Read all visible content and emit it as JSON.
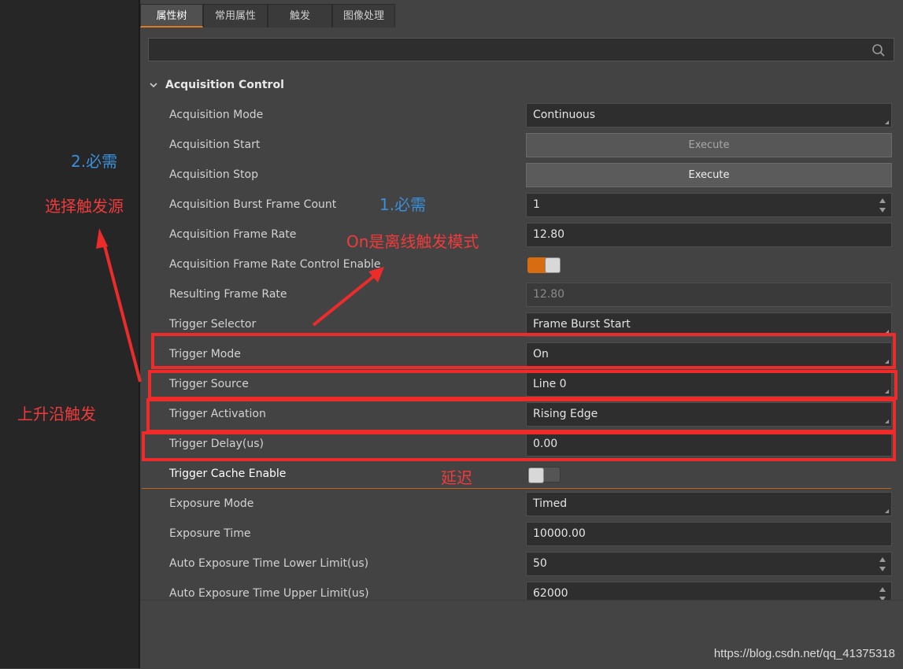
{
  "tabs": [
    "属性树",
    "常用属性",
    "触发",
    "图像处理"
  ],
  "search": {
    "placeholder": ""
  },
  "section": {
    "title": "Acquisition Control"
  },
  "rows": [
    {
      "label": "Acquisition Mode",
      "value": "Continuous"
    },
    {
      "label": "Acquisition Start",
      "value": "Execute"
    },
    {
      "label": "Acquisition Stop",
      "value": "Execute"
    },
    {
      "label": "Acquisition Burst Frame Count",
      "value": "1"
    },
    {
      "label": "Acquisition Frame Rate",
      "value": "12.80"
    },
    {
      "label": "Acquisition Frame Rate Control Enable",
      "value": "on"
    },
    {
      "label": "Resulting Frame Rate",
      "value": "12.80"
    },
    {
      "label": "Trigger Selector",
      "value": "Frame Burst Start"
    },
    {
      "label": "Trigger Mode",
      "value": "On"
    },
    {
      "label": "Trigger Source",
      "value": "Line 0"
    },
    {
      "label": "Trigger Activation",
      "value": "Rising Edge"
    },
    {
      "label": "Trigger Delay(us)",
      "value": "0.00"
    },
    {
      "label": "Trigger Cache Enable",
      "value": "off"
    },
    {
      "label": "Exposure Mode",
      "value": "Timed"
    },
    {
      "label": "Exposure Time",
      "value": "10000.00"
    },
    {
      "label": "Auto Exposure Time Lower Limit(us)",
      "value": "50"
    },
    {
      "label": "Auto Exposure Time Upper Limit(us)",
      "value": "62000"
    }
  ],
  "annotations": {
    "required_2": "2.必需",
    "select_source": "选择触发源",
    "required_1": "1.必需",
    "on_offline": "On是离线触发模式",
    "rising_edge": "上升沿触发",
    "delay": "延迟"
  },
  "watermark": "https://blog.csdn.net/qq_41375318",
  "colors": {
    "accent": "#e07a1e",
    "annotation_red": "#ee2b2b",
    "annotation_blue": "#3a8fd8"
  }
}
